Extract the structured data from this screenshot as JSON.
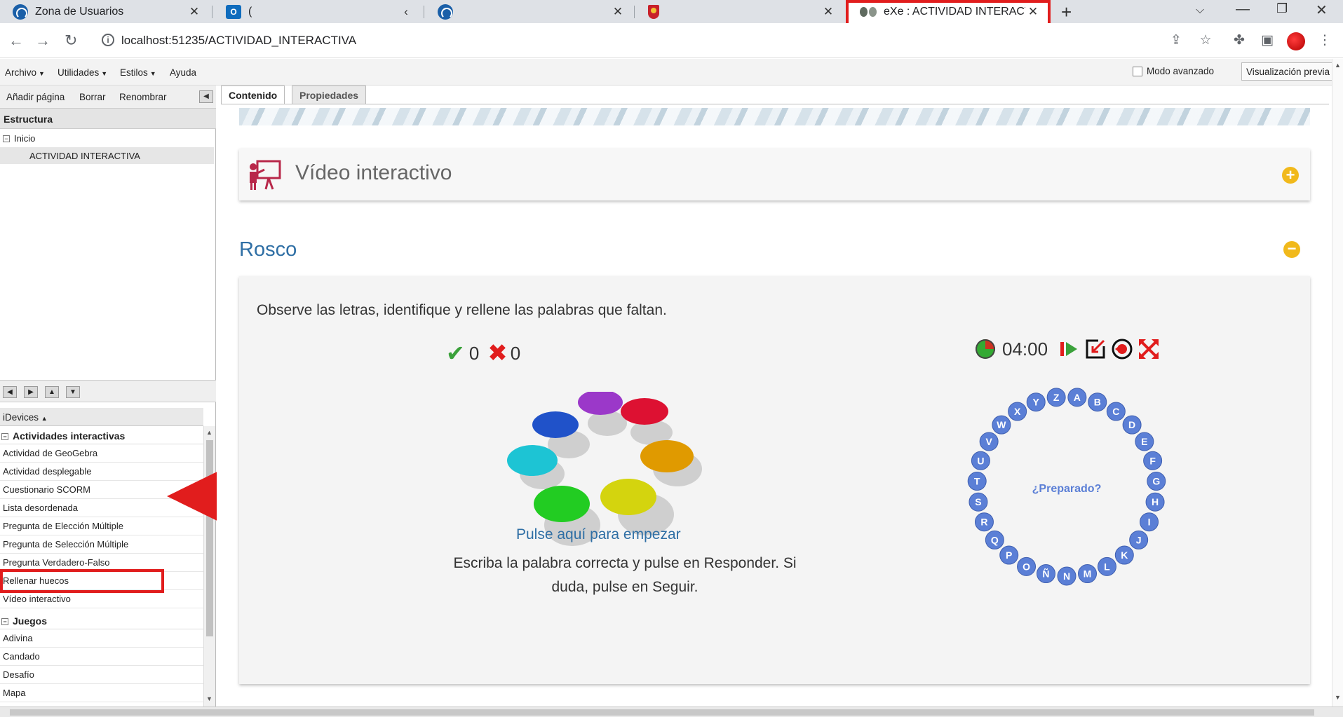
{
  "browser": {
    "tabs": [
      {
        "title": "Zona de Usuarios",
        "favicon": "circle-logo-icon"
      },
      {
        "title": "(",
        "favicon": "outlook-icon"
      },
      {
        "title": "",
        "favicon": "circle-logo-icon"
      },
      {
        "title": "",
        "favicon": "crest-icon"
      },
      {
        "title": "eXe : ACTIVIDAD INTERACTIVA",
        "favicon": "exe-logo-icon",
        "active": true
      }
    ],
    "url": "localhost:51235/ACTIVIDAD_INTERACTIVA",
    "new_tab": "+",
    "close_glyph": "✕"
  },
  "menubar": {
    "items": [
      "Archivo",
      "Utilidades",
      "Estilos",
      "Ayuda"
    ],
    "modo_avanzado": "Modo avanzado",
    "preview": "Visualización previa"
  },
  "structure": {
    "actions": [
      "Añadir página",
      "Borrar",
      "Renombrar"
    ],
    "header": "Estructura",
    "root": "Inicio",
    "selected": "ACTIVIDAD INTERACTIVA"
  },
  "idevices": {
    "header": "iDevices",
    "groups": [
      {
        "name": "Actividades interactivas",
        "items": [
          "Actividad de GeoGebra",
          "Actividad desplegable",
          "Cuestionario SCORM",
          "Lista desordenada",
          "Pregunta de Elección Múltiple",
          "Pregunta de Selección Múltiple",
          "Pregunta Verdadero-Falso",
          "Rellenar huecos",
          "Vídeo interactivo"
        ]
      },
      {
        "name": "Juegos",
        "items": [
          "Adivina",
          "Candado",
          "Desafío",
          "Mapa"
        ]
      }
    ]
  },
  "content": {
    "tabs": [
      "Contenido",
      "Propiedades"
    ],
    "video_title": "Vídeo interactivo",
    "rosco_title": "Rosco",
    "instructions": "Observe las letras, identifique y rellene las palabras que faltan.",
    "hits": "0",
    "errors": "0",
    "timer": "04:00",
    "start_link": "Pulse aquí para empezar",
    "help": "Escriba la palabra correcta y pulse en Responder. Si duda, pulse en Seguir.",
    "ready": "¿Preparado?",
    "letters": [
      "A",
      "B",
      "C",
      "D",
      "E",
      "F",
      "G",
      "H",
      "I",
      "J",
      "K",
      "L",
      "M",
      "N",
      "Ñ",
      "O",
      "P",
      "Q",
      "R",
      "S",
      "T",
      "U",
      "V",
      "W",
      "X",
      "Y",
      "Z"
    ],
    "colors": {
      "accent": "#2f6fa5",
      "letter": "#5b7fd6",
      "plus": "#f1b91b",
      "highlight": "#e11d1d"
    }
  }
}
